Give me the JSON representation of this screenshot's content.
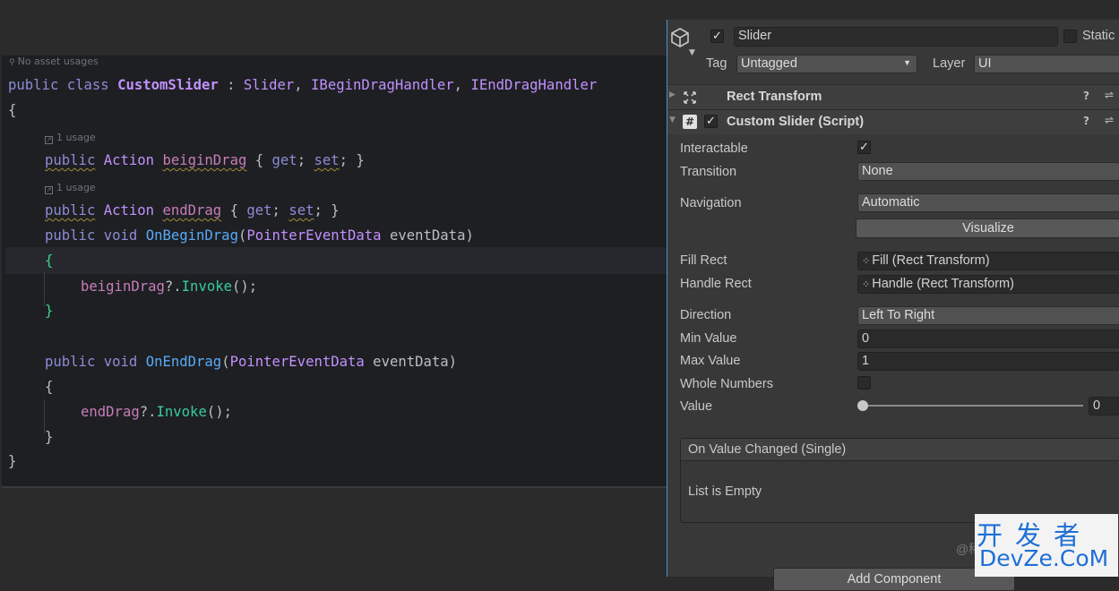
{
  "editor": {
    "usage_hint": "No asset usages",
    "class_line": {
      "kw1": "public",
      "kw2": "class",
      "name": "CustomSlider",
      "sep": " : ",
      "base": "Slider",
      "c1": ", ",
      "i1": "IBeginDragHandler",
      "c2": ", ",
      "i2": "IEndDragHandler"
    },
    "open_brace": "{",
    "close_brace": "}",
    "usage1": "1 usage",
    "usage2": "1 usage",
    "prop1": {
      "kw": "public",
      "type": "Action",
      "name": "beiginDrag",
      "open": " { ",
      "get": "get",
      "semi1": "; ",
      "set": "set",
      "semi2": "; }"
    },
    "prop2": {
      "kw": "public",
      "type": "Action",
      "name": "endDrag",
      "open": " { ",
      "get": "get",
      "semi1": "; ",
      "set": "set",
      "semi2": "; }"
    },
    "method1": {
      "kw": "public",
      "ret": "void",
      "name": "OnBeginDrag",
      "paren": "(",
      "ptype": "PointerEventData",
      "pname": " eventData)"
    },
    "method1_body": {
      "target": "beiginDrag",
      "op": "?.",
      "call": "Invoke",
      "end": "();"
    },
    "method2": {
      "kw": "public",
      "ret": "void",
      "name": "OnEndDrag",
      "paren": "(",
      "ptype": "PointerEventData",
      "pname": " eventData)"
    },
    "method2_body": {
      "target": "endDrag",
      "op": "?.",
      "call": "Invoke",
      "end": "();"
    }
  },
  "inspector": {
    "object_name": "Slider",
    "static_label": "Static",
    "tag_label": "Tag",
    "tag_value": "Untagged",
    "layer_label": "Layer",
    "layer_value": "UI",
    "rect_transform_header": "Rect Transform",
    "script_header": "Custom Slider (Script)",
    "fields": {
      "interactable": {
        "label": "Interactable",
        "checked": true
      },
      "transition": {
        "label": "Transition",
        "value": "None"
      },
      "navigation": {
        "label": "Navigation",
        "value": "Automatic"
      },
      "visualize": "Visualize",
      "fill_rect": {
        "label": "Fill Rect",
        "value": "Fill (Rect Transform)"
      },
      "handle_rect": {
        "label": "Handle Rect",
        "value": "Handle (Rect Transform)"
      },
      "direction": {
        "label": "Direction",
        "value": "Left To Right"
      },
      "min_value": {
        "label": "Min Value",
        "value": "0"
      },
      "max_value": {
        "label": "Max Value",
        "value": "1"
      },
      "whole_numbers": {
        "label": "Whole Numbers",
        "checked": false
      },
      "value": {
        "label": "Value",
        "value": "0",
        "slider_fraction": 0
      }
    },
    "event_header": "On Value Changed (Single)",
    "event_empty": "List is Empty",
    "add_component": "Add Component"
  },
  "watermark": {
    "line1": "开发者",
    "line2": "DevZe.CoM",
    "faded": "@稀"
  },
  "colors": {
    "keyword": "#8c8cd6",
    "type": "#c191ff",
    "property": "#c77dbb",
    "method": "#57aaf7",
    "call": "#39cc9b",
    "accent": "#4a90c8"
  }
}
